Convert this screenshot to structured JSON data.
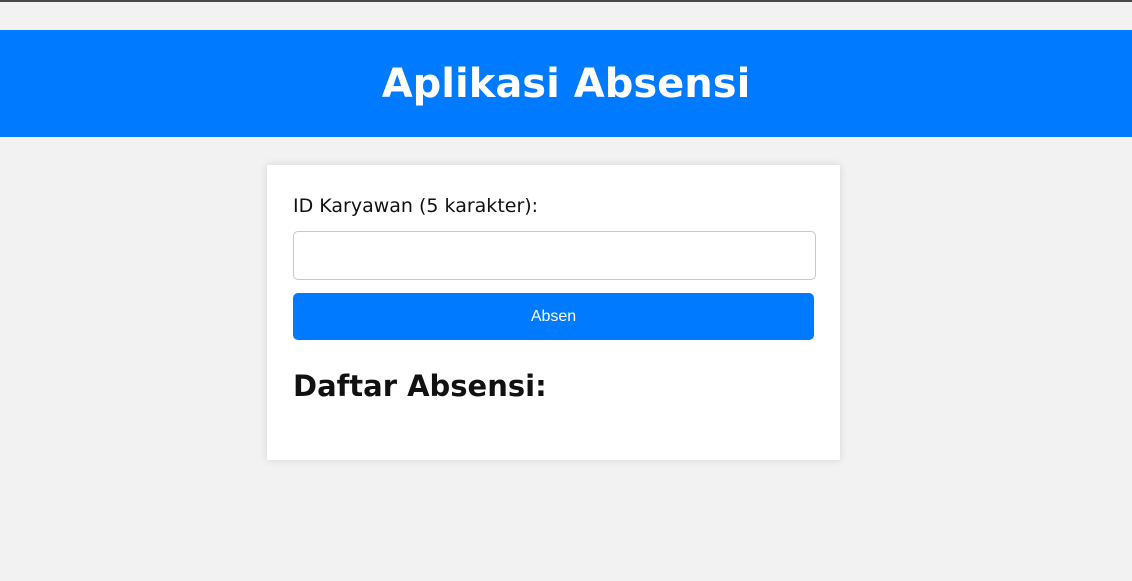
{
  "header": {
    "title": "Aplikasi Absensi"
  },
  "form": {
    "id_label": "ID Karyawan (5 karakter):",
    "id_value": "",
    "id_placeholder": "",
    "submit_label": "Absen"
  },
  "attendance": {
    "title": "Daftar Absensi:",
    "entries": []
  },
  "colors": {
    "accent": "#007bff",
    "background": "#f2f2f2",
    "card": "#ffffff"
  }
}
